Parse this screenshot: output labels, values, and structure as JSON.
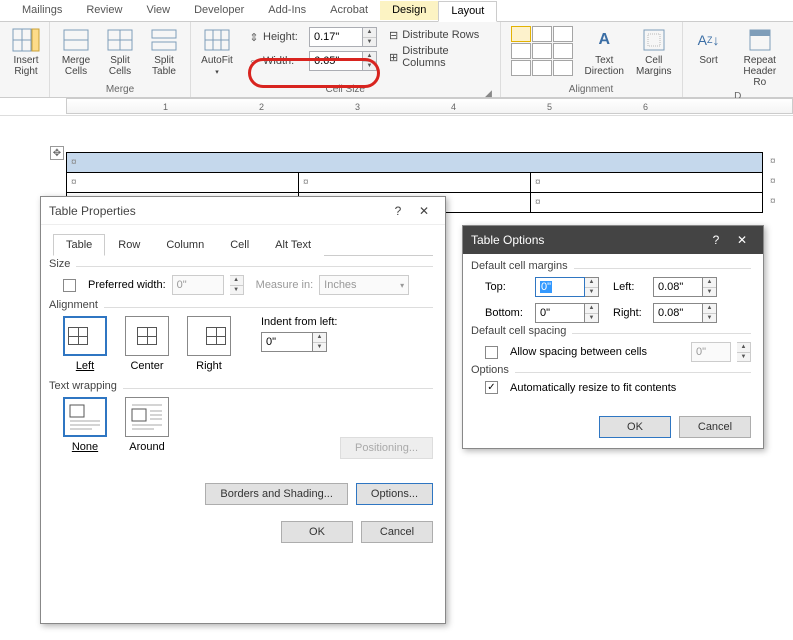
{
  "menu": {
    "tabs": [
      "Mailings",
      "Review",
      "View",
      "Developer",
      "Add-Ins",
      "Acrobat",
      "Design",
      "Layout"
    ]
  },
  "ribbon": {
    "merge": {
      "insert_right": "Insert\nRight",
      "merge_cells": "Merge\nCells",
      "split_cells": "Split\nCells",
      "split_table": "Split\nTable",
      "label": "Merge"
    },
    "cellsize": {
      "autofit": "AutoFit",
      "height_label": "Height:",
      "height_val": "0.17\"",
      "width_label": "Width:",
      "width_val": "6.65\"",
      "dist_rows": "Distribute Rows",
      "dist_cols": "Distribute Columns",
      "label": "Cell Size"
    },
    "alignment": {
      "text_dir": "Text\nDirection",
      "cell_margins": "Cell\nMargins",
      "label": "Alignment"
    },
    "data": {
      "sort": "Sort",
      "repeat": "Repeat\nHeader Ro",
      "label": "D"
    }
  },
  "ruler_nums": [
    "1",
    "2",
    "3",
    "4",
    "5",
    "6"
  ],
  "tableprops": {
    "title": "Table Properties",
    "tabs": [
      "Table",
      "Row",
      "Column",
      "Cell",
      "Alt Text"
    ],
    "size_label": "Size",
    "pref_width": "Preferred width:",
    "pref_width_val": "0\"",
    "measure_in": "Measure in:",
    "measure_unit": "Inches",
    "alignment_label": "Alignment",
    "indent_label": "Indent from left:",
    "indent_val": "0\"",
    "align": {
      "left": "Left",
      "center": "Center",
      "right": "Right"
    },
    "wrap_label": "Text wrapping",
    "wrap": {
      "none": "None",
      "around": "Around"
    },
    "positioning": "Positioning...",
    "borders": "Borders and Shading...",
    "options": "Options...",
    "ok": "OK",
    "cancel": "Cancel"
  },
  "tableopts": {
    "title": "Table Options",
    "margins_label": "Default cell margins",
    "top": "Top:",
    "top_val": "0\"",
    "left": "Left:",
    "left_val": "0.08\"",
    "bottom": "Bottom:",
    "bottom_val": "0\"",
    "right": "Right:",
    "right_val": "0.08\"",
    "spacing_label": "Default cell spacing",
    "allow_spacing": "Allow spacing between cells",
    "spacing_val": "0\"",
    "options_label": "Options",
    "auto_resize": "Automatically resize to fit contents",
    "ok": "OK",
    "cancel": "Cancel"
  }
}
